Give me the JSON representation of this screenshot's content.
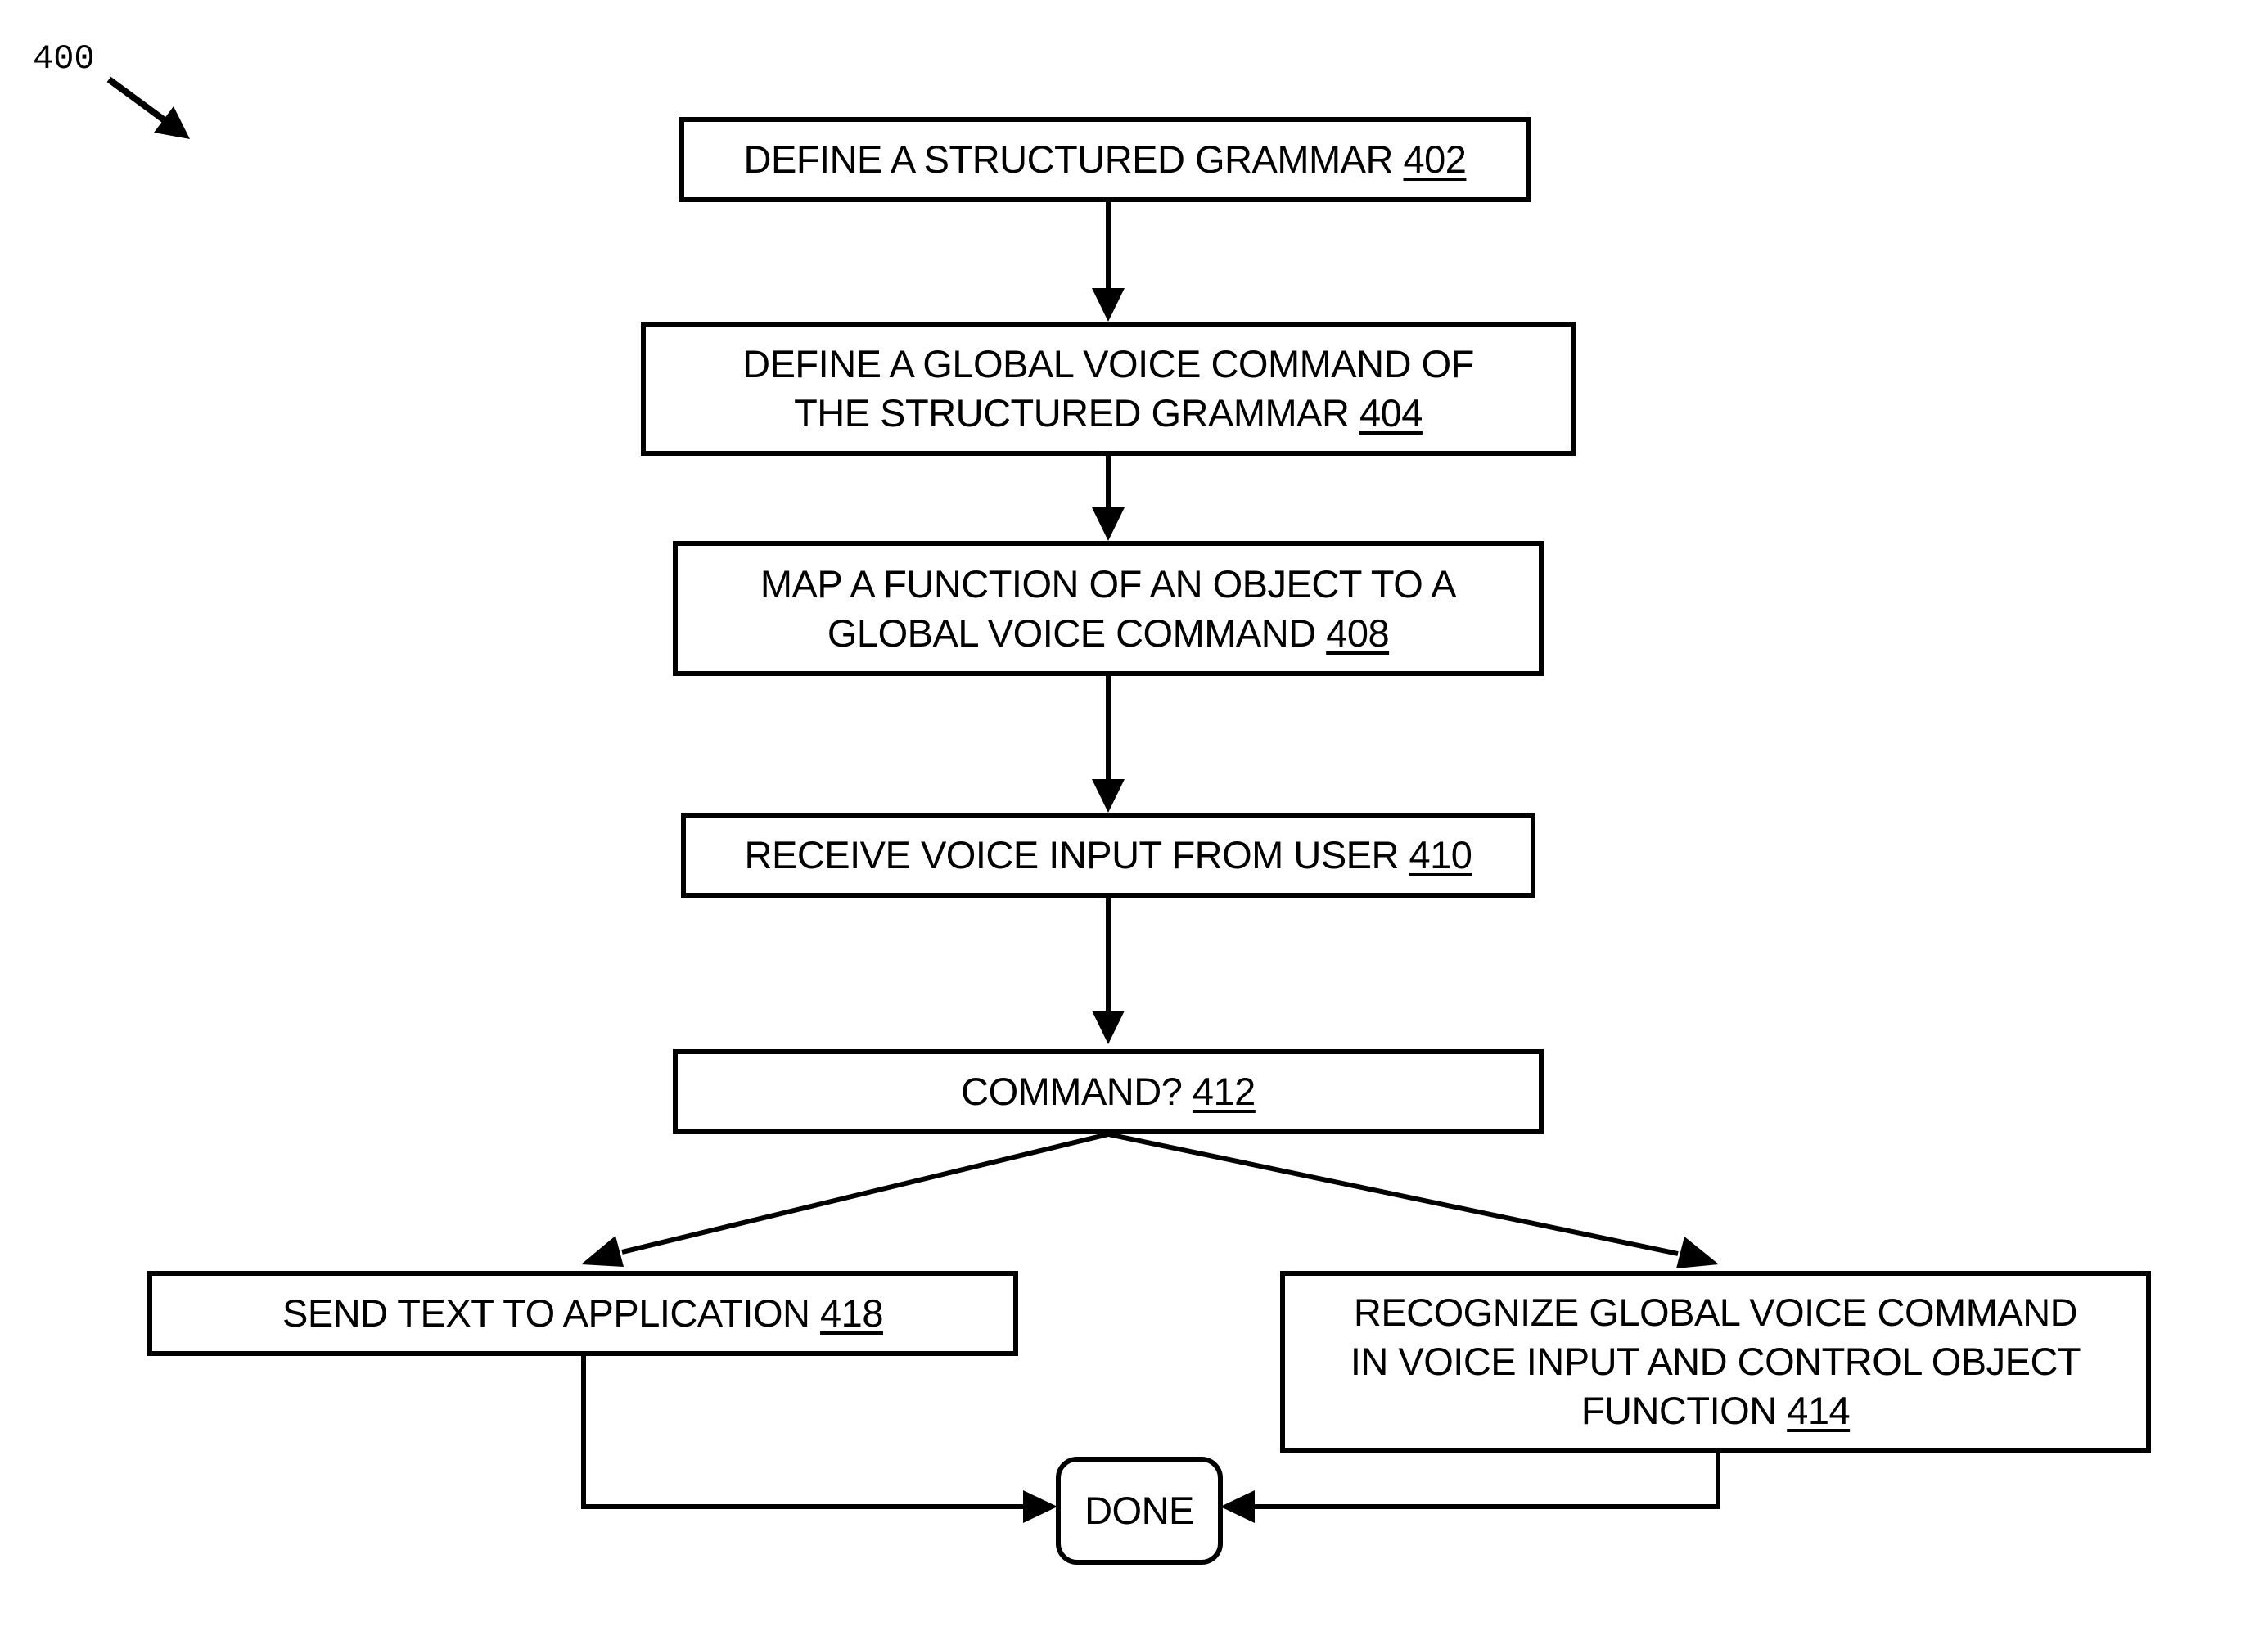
{
  "figure": {
    "label": "400",
    "label_arrow_icon": "arrow-down-right-icon"
  },
  "steps": [
    {
      "id": "402",
      "lines": [
        "DEFINE A STRUCTURED GRAMMAR"
      ],
      "ref": "402"
    },
    {
      "id": "404",
      "lines": [
        "DEFINE A GLOBAL VOICE COMMAND OF",
        "THE STRUCTURED GRAMMAR"
      ],
      "ref": "404"
    },
    {
      "id": "408",
      "lines": [
        "MAP A FUNCTION OF AN OBJECT TO A",
        "GLOBAL VOICE COMMAND"
      ],
      "ref": "408"
    },
    {
      "id": "410",
      "lines": [
        "RECEIVE VOICE INPUT FROM USER"
      ],
      "ref": "410"
    },
    {
      "id": "412",
      "lines": [
        "COMMAND?"
      ],
      "ref": "412"
    },
    {
      "id": "418",
      "lines": [
        "SEND TEXT TO APPLICATION"
      ],
      "ref": "418"
    },
    {
      "id": "414",
      "lines": [
        "RECOGNIZE GLOBAL VOICE COMMAND",
        "IN VOICE INPUT AND CONTROL OBJECT",
        "FUNCTION"
      ],
      "ref": "414"
    }
  ],
  "terminal": {
    "label": "DONE"
  },
  "edges": [
    {
      "from": "402",
      "to": "404"
    },
    {
      "from": "404",
      "to": "408"
    },
    {
      "from": "408",
      "to": "410"
    },
    {
      "from": "410",
      "to": "412"
    },
    {
      "from": "412",
      "to": "418"
    },
    {
      "from": "412",
      "to": "414"
    },
    {
      "from": "418",
      "to": "DONE"
    },
    {
      "from": "414",
      "to": "DONE"
    }
  ]
}
